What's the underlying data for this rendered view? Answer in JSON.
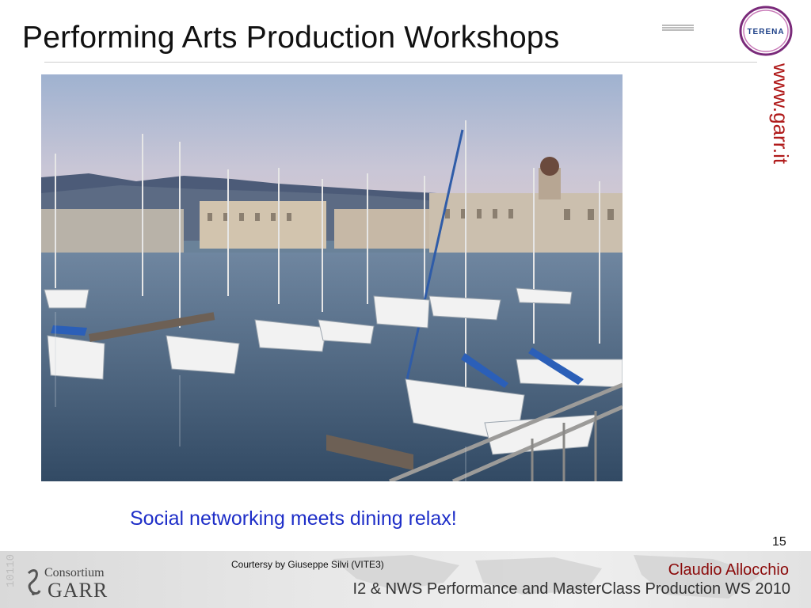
{
  "slide": {
    "title": "Performing Arts Production Workshops",
    "caption": "Social networking meets dining relax!",
    "page_number": "15"
  },
  "logos": {
    "terena": "TERENA",
    "garr_url": "www.garr.it",
    "consortium_line1": "Consortium",
    "consortium_line2": "GARR"
  },
  "footer": {
    "credit": "Courtersy by Giuseppe Silvi (VITE3)",
    "author": "Claudio Allocchio",
    "event": "I2 & NWS Performance and MasterClass Production WS 2010"
  },
  "colors": {
    "caption": "#1e2ec8",
    "author": "#8b0a0a",
    "terena_ring": "#7a2a7a",
    "garr_red": "#b01a1a"
  }
}
